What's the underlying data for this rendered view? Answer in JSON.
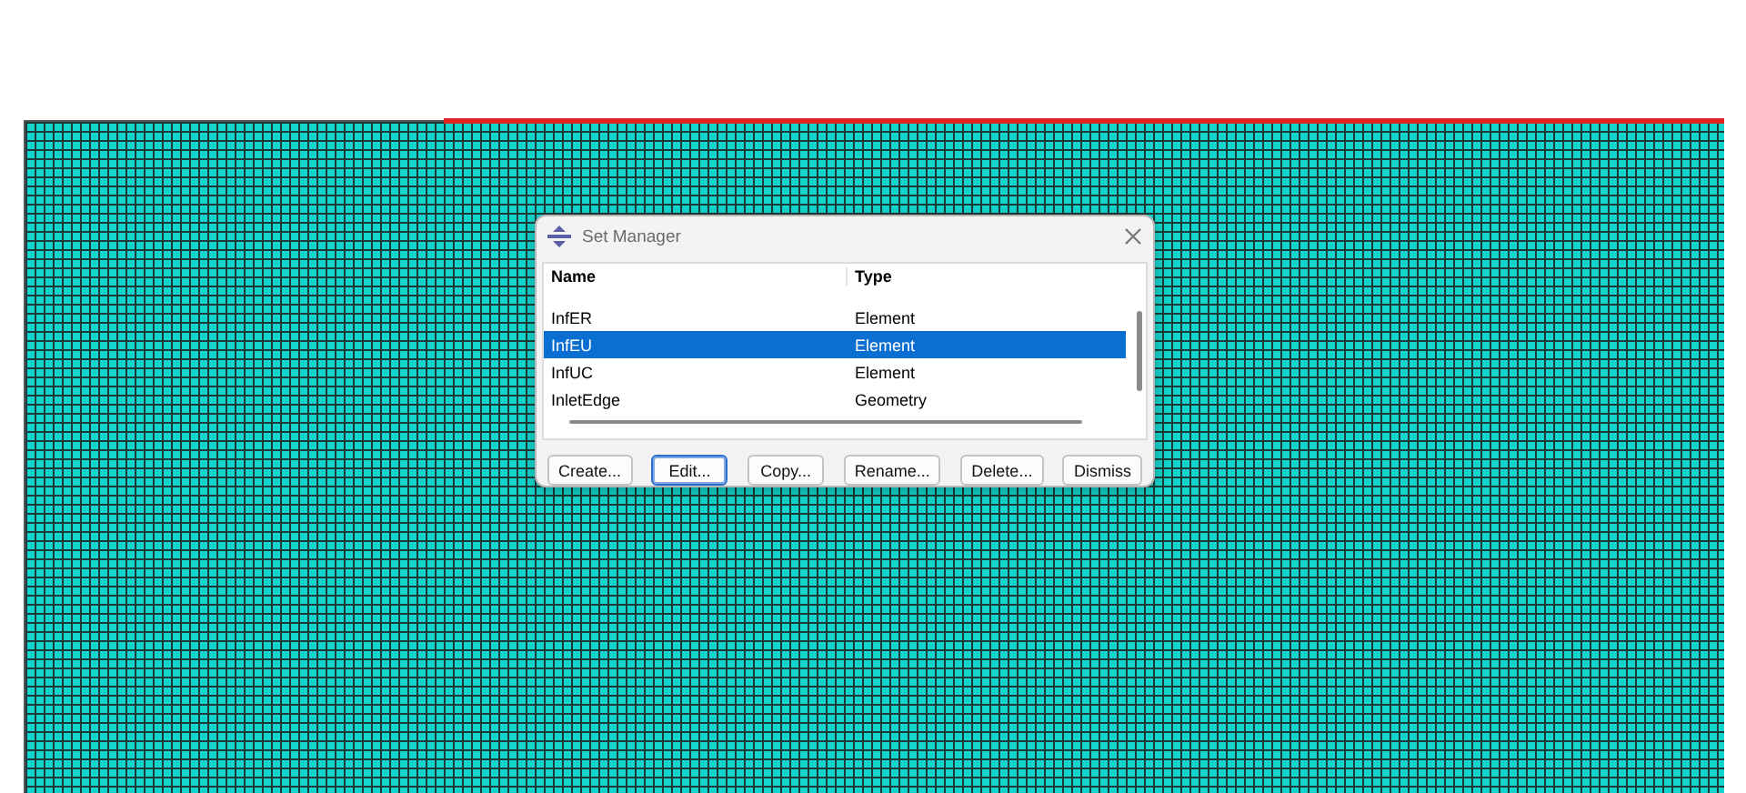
{
  "viewport": {
    "highlighted_edge": true
  },
  "dialog": {
    "title": "Set Manager",
    "columns": [
      "Name",
      "Type"
    ],
    "rows": [
      {
        "name": "InfER",
        "type": "Element",
        "selected": false
      },
      {
        "name": "InfEU",
        "type": "Element",
        "selected": true
      },
      {
        "name": "InfUC",
        "type": "Element",
        "selected": false
      },
      {
        "name": "InletEdge",
        "type": "Geometry",
        "selected": false
      }
    ],
    "buttons": [
      {
        "label": "Create...",
        "focused": false
      },
      {
        "label": "Edit...",
        "focused": true
      },
      {
        "label": "Copy...",
        "focused": false
      },
      {
        "label": "Rename...",
        "focused": false
      },
      {
        "label": "Delete...",
        "focused": false
      },
      {
        "label": "Dismiss",
        "focused": false
      }
    ]
  }
}
